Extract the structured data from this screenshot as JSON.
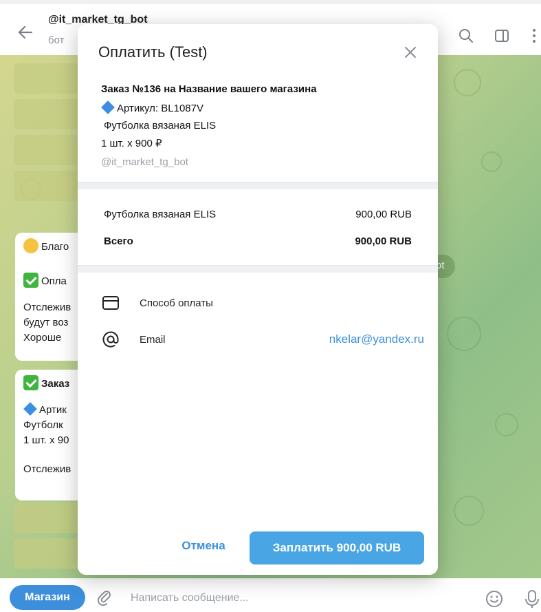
{
  "header": {
    "chat_name": "@it_market_tg_bot",
    "chat_subtitle": "бот"
  },
  "chat": {
    "bubble1": {
      "line1": "Благо",
      "line2": "Опла",
      "line3": "Отслежив",
      "line4": "будут воз",
      "line5": "Хороше"
    },
    "bubble2": {
      "line1": "Заказ",
      "line2": "Артик",
      "line3": "Футболк",
      "line4": "1 шт. х 90",
      "line5": "Отслежив"
    },
    "side_pill": "ot"
  },
  "modal": {
    "title": "Оплатить (Test)",
    "order_title": "Заказ №136 на Название вашего магазина",
    "order_article": "Артикул: BL1087V",
    "order_item": "Футболка вязаная ELIS",
    "order_qty": "1 шт. х 900 ₽",
    "bot_name": "@it_market_tg_bot",
    "summary": {
      "item_label": "Футболка вязаная ELIS",
      "item_value": "900,00 RUB",
      "total_label": "Всего",
      "total_value": "900,00 RUB"
    },
    "payment_method_label": "Способ оплаты",
    "email_label": "Email",
    "email_value": "nkelar@yandex.ru",
    "cancel_label": "Отмена",
    "pay_label": "Заплатить 900,00 RUB"
  },
  "input_bar": {
    "shop_button": "Магазин",
    "placeholder": "Написать сообщение..."
  },
  "colors": {
    "accent": "#3d8fdb",
    "pay_button": "#4aa5e4",
    "chat_background": "#b8cf8e"
  }
}
